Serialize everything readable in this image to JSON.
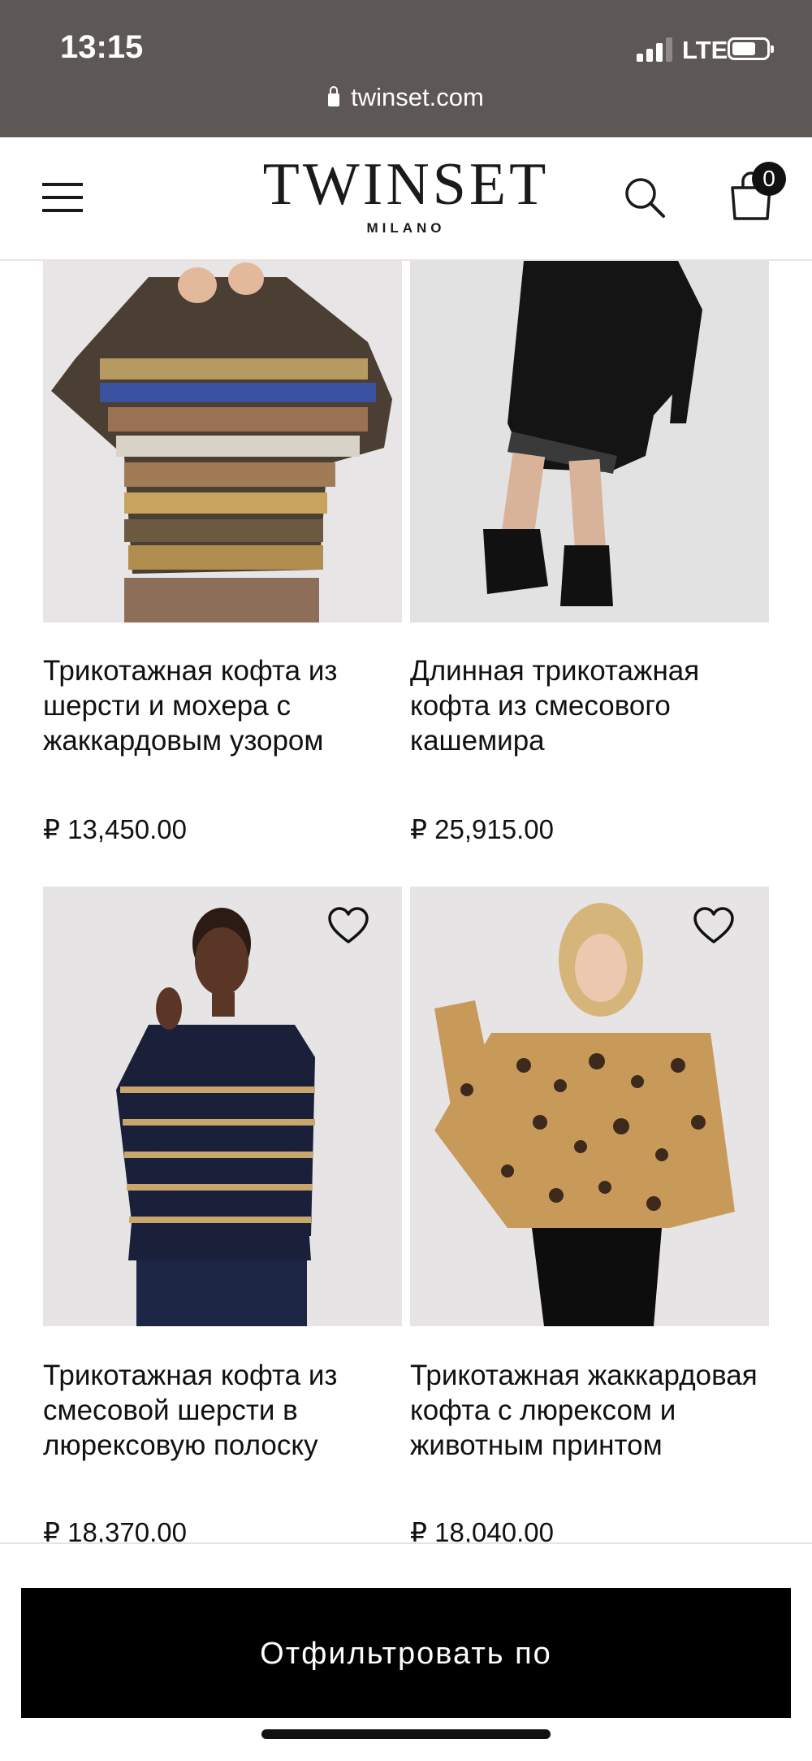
{
  "status_bar": {
    "time": "13:15",
    "network": "LTE"
  },
  "browser": {
    "url": "twinset.com"
  },
  "header": {
    "brand": "TWINSET",
    "sub_brand": "MILANO",
    "cart_count": "0"
  },
  "products": [
    {
      "title": "Трикотажная кофта из шерсти и мохера с жаккардовым узором",
      "price": "₽ 13,450.00",
      "image": "patterned-knit-sweater-photo"
    },
    {
      "title": "Длинная трикотажная кофта из смесового кашемира",
      "price": "₽ 25,915.00",
      "image": "black-knit-dress-photo"
    },
    {
      "title": "Трикотажная кофта из смесовой шерсти в люрексовую полоску",
      "price": "₽ 18,370.00",
      "image": "navy-striped-sweater-photo"
    },
    {
      "title": "Трикотажная жаккардовая кофта с люрексом и животным принтом",
      "price": "₽ 18,040.00",
      "image": "leopard-sweater-photo"
    }
  ],
  "filter": {
    "label": "Отфильтровать по"
  }
}
